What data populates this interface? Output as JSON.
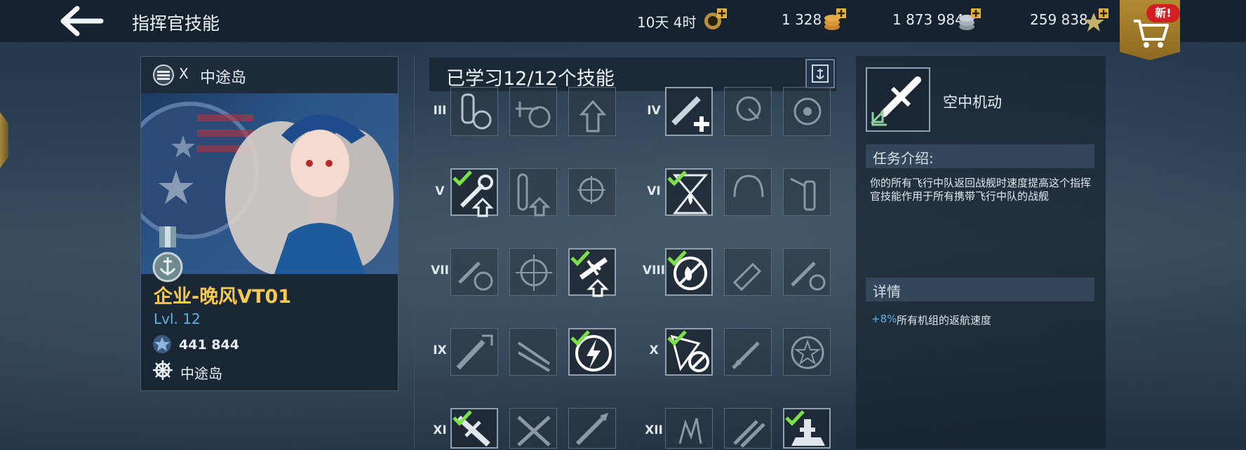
{
  "header": {
    "title": "指挥官技能",
    "resources": [
      {
        "value": "10天 4时",
        "icon": "premium-time-icon"
      },
      {
        "value": "1 328",
        "icon": "doubloons-icon"
      },
      {
        "value": "1 873 984",
        "icon": "credits-icon"
      },
      {
        "value": "259 838",
        "icon": "free-xp-icon"
      }
    ],
    "shop_badge": "新!"
  },
  "commander": {
    "tier": "X",
    "ship": "中途岛",
    "name": "企业-晚风VT01",
    "level": "Lvl. 12",
    "xp": "441 844",
    "current_ship": "中途岛"
  },
  "tree": {
    "learned": "已学习12/12个技能",
    "rows": [
      "III",
      "IV",
      "V",
      "VI",
      "VII",
      "VIII",
      "IX",
      "X",
      "XI",
      "XII"
    ]
  },
  "detail": {
    "name": "空中机动",
    "section_task": "任务介绍:",
    "description": "你的所有飞行中队返回战舰时速度提高这个指挥官技能作用于所有携带飞行中队的战舰",
    "section_details": "详情",
    "stat_value": "+8%",
    "stat_text": "所有机组的返航速度"
  },
  "colors": {
    "accent_gold": "#f5c94f",
    "level_blue": "#5fb3e6",
    "check_green": "#7be04a",
    "badge_red": "#d21f24"
  }
}
